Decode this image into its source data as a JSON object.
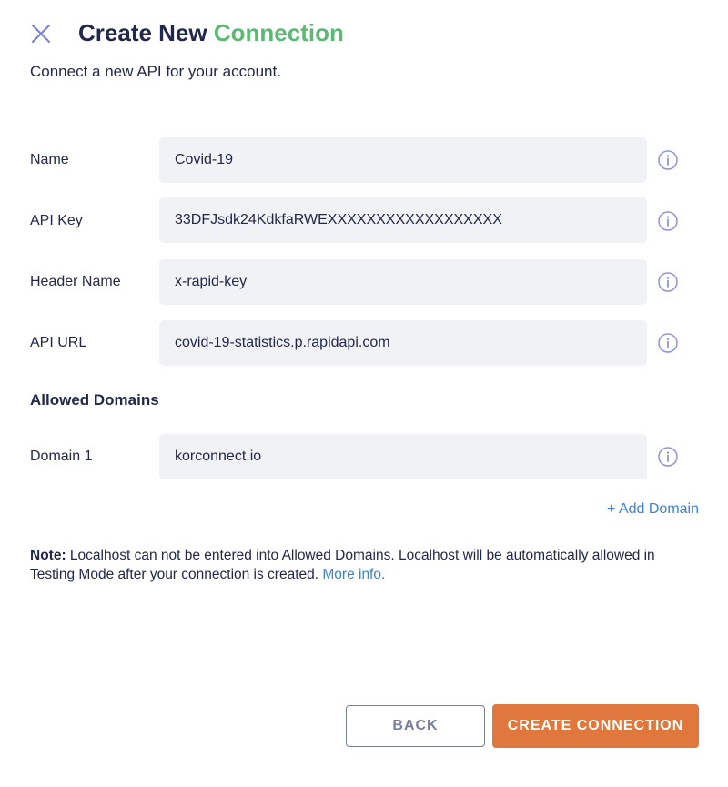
{
  "header": {
    "title_main": "Create New",
    "title_accent": "Connection",
    "subtitle": "Connect a new API for your account."
  },
  "fields": [
    {
      "label": "Name",
      "value": "Covid-19"
    },
    {
      "label": "API Key",
      "value": "33DFJsdk24KdkfaRWEXXXXXXXXXXXXXXXXXX"
    },
    {
      "label": "Header Name",
      "value": "x-rapid-key"
    },
    {
      "label": "API URL",
      "value": "covid-19-statistics.p.rapidapi.com"
    }
  ],
  "allowed_domains": {
    "title": "Allowed Domains",
    "domains": [
      {
        "label": "Domain 1",
        "value": "korconnect.io"
      }
    ],
    "add_label": "+ Add Domain"
  },
  "note": {
    "prefix": "Note:",
    "text": " Localhost can not be entered into Allowed Domains. Localhost will be automatically allowed in Testing Mode after your connection is created. ",
    "link": "More info."
  },
  "buttons": {
    "back": "BACK",
    "create": "CREATE CONNECTION"
  },
  "colors": {
    "accent": "#5cb874",
    "primary_button": "#e0773d",
    "link": "#3a83d4",
    "text": "#22284a",
    "input_bg": "#f1f2f6"
  },
  "icons": {
    "close": "close-icon",
    "info": "info-icon"
  }
}
